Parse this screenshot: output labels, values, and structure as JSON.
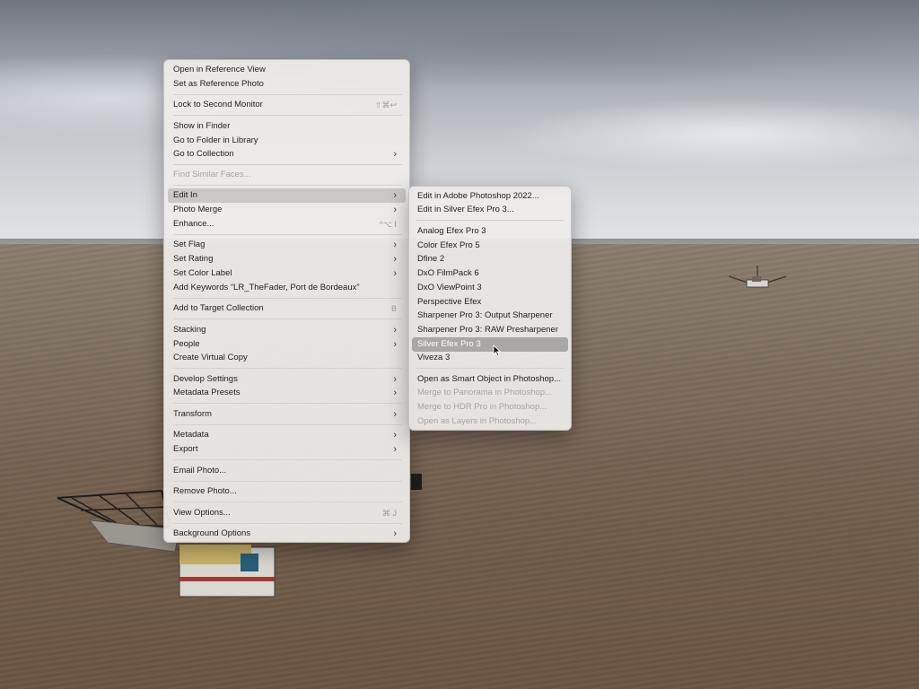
{
  "context_menu": {
    "items": [
      {
        "label": "Open in Reference View"
      },
      {
        "label": "Set as Reference Photo"
      },
      {
        "label": "Lock to Second Monitor",
        "shortcut": "⇧⌘↩"
      },
      {
        "label": "Show in Finder"
      },
      {
        "label": "Go to Folder in Library"
      },
      {
        "label": "Go to Collection"
      },
      {
        "label": "Find Similar Faces..."
      },
      {
        "label": "Edit In"
      },
      {
        "label": "Photo Merge"
      },
      {
        "label": "Enhance...",
        "shortcut": "^⌥ I"
      },
      {
        "label": "Set Flag"
      },
      {
        "label": "Set Rating"
      },
      {
        "label": "Set Color Label"
      },
      {
        "label": "Add Keywords “LR_TheFader, Port de Bordeaux”"
      },
      {
        "label": "Add to Target Collection",
        "shortcut": "B"
      },
      {
        "label": "Stacking"
      },
      {
        "label": "People"
      },
      {
        "label": "Create Virtual Copy"
      },
      {
        "label": "Develop Settings"
      },
      {
        "label": "Metadata Presets"
      },
      {
        "label": "Transform"
      },
      {
        "label": "Metadata"
      },
      {
        "label": "Export"
      },
      {
        "label": "Email Photo..."
      },
      {
        "label": "Remove Photo..."
      },
      {
        "label": "View Options...",
        "shortcut": "⌘ J"
      },
      {
        "label": "Background Options"
      }
    ]
  },
  "edit_in_submenu": {
    "items": [
      {
        "label": "Edit in Adobe Photoshop 2022..."
      },
      {
        "label": "Edit in Silver Efex Pro 3..."
      },
      {
        "label": "Analog Efex Pro 3"
      },
      {
        "label": "Color Efex Pro 5"
      },
      {
        "label": "Dfine 2"
      },
      {
        "label": "DxO FilmPack 6"
      },
      {
        "label": "DxO ViewPoint 3"
      },
      {
        "label": "Perspective Efex"
      },
      {
        "label": "Sharpener Pro 3: Output Sharpener"
      },
      {
        "label": "Sharpener Pro 3: RAW Presharpener"
      },
      {
        "label": "Silver Efex Pro 3"
      },
      {
        "label": "Viveza 3"
      },
      {
        "label": "Open as Smart Object in Photoshop..."
      },
      {
        "label": "Merge to Panorama in Photoshop..."
      },
      {
        "label": "Merge to HDR Pro in Photoshop..."
      },
      {
        "label": "Open as Layers in Photoshop..."
      }
    ]
  },
  "icons": {
    "submenu_arrow": "chevron-right-icon",
    "pointer": "mouse-pointer-icon"
  },
  "colors": {
    "menu_bg": "#eeece9",
    "highlight": "#c9c8c6",
    "selected": "#a9a8a6",
    "disabled_text": "#a7a5a2"
  }
}
